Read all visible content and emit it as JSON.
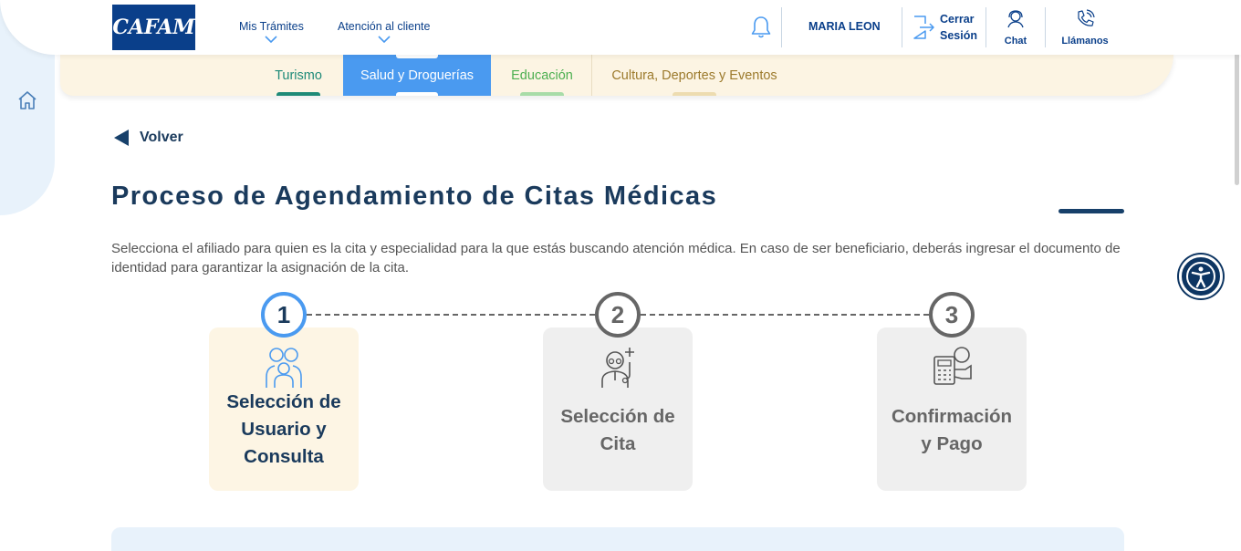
{
  "header": {
    "logo_text": "CAFAM",
    "nav": [
      {
        "label": "Mis Trámites"
      },
      {
        "label": "Atención al cliente"
      }
    ],
    "user_name": "MARIA LEON",
    "logout_line1": "Cerrar",
    "logout_line2": "Sesión",
    "chat_label": "Chat",
    "call_label": "Llámanos"
  },
  "tabs": [
    {
      "label": "Turismo",
      "color": "#1e8a78",
      "active": false
    },
    {
      "label": "Salud y Droguerías",
      "color": "#4a9af0",
      "active": true
    },
    {
      "label": "Educación",
      "color": "#4caf50",
      "active": false
    },
    {
      "label": "Cultura, Deportes y Eventos",
      "color": "#9c7a2c",
      "active": false
    }
  ],
  "back_label": "Volver",
  "page_title": "Proceso de Agendamiento de Citas Médicas",
  "description": "Selecciona el afiliado para quien es la cita y especialidad para la que estás buscando atención médica. En caso de ser beneficiario, deberás ingresar el documento de identidad para garantizar la asignación de la cita.",
  "steps": [
    {
      "number": "1",
      "line1": "Selección de",
      "line2": "Usuario y",
      "line3": "Consulta",
      "icon": "family-icon",
      "active": true
    },
    {
      "number": "2",
      "line1": "Selección de",
      "line2": "Cita",
      "icon": "doctor-icon",
      "active": false
    },
    {
      "number": "3",
      "line1": "Confirmación",
      "line2": "y Pago",
      "icon": "payment-icon",
      "active": false
    }
  ],
  "colors": {
    "brand": "#0a3f8a",
    "title": "#1a3a5c",
    "active_step_bg": "#fdf5e4",
    "inactive_step_bg": "#efefef",
    "active_step_ring": "#4a9af0"
  }
}
